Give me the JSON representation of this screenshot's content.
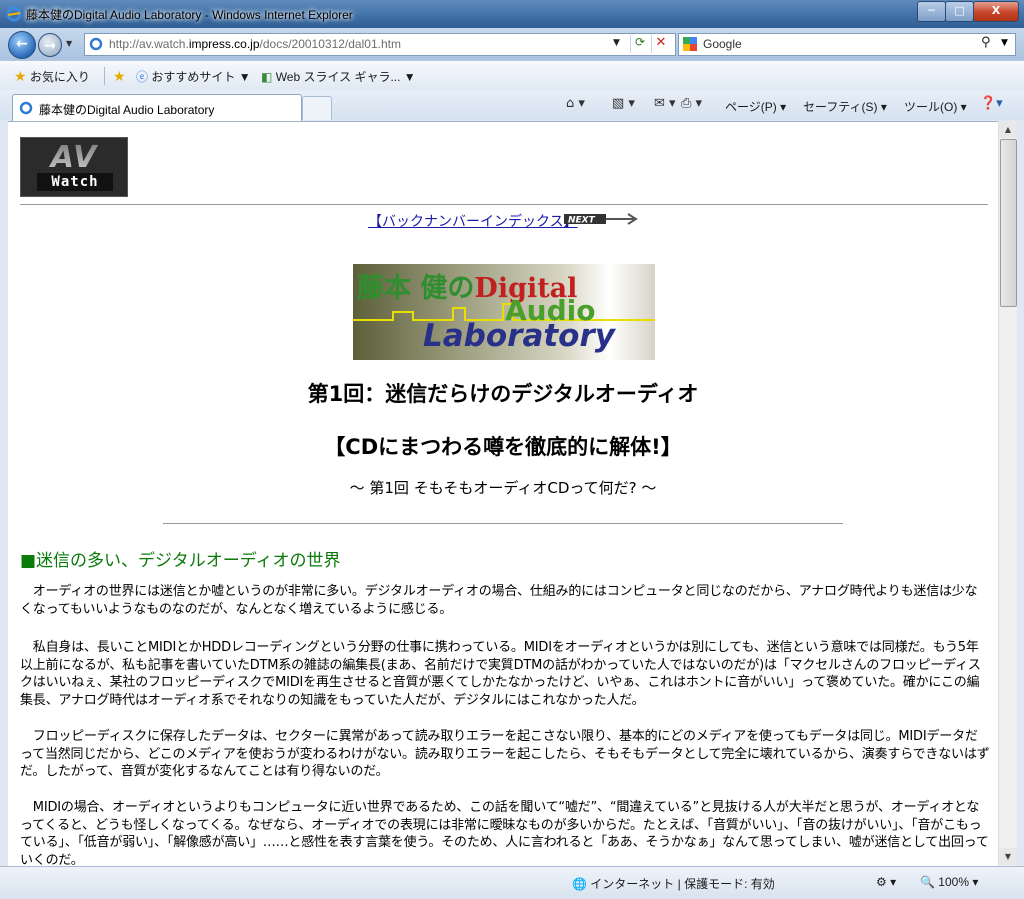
{
  "window": {
    "title": "藤本健のDigital Audio Laboratory - Windows Internet Explorer",
    "min_label": "─",
    "max_label": "□",
    "close_label": "X"
  },
  "nav": {
    "url_prefix": "http://av.watch.",
    "url_domain": "impress.co.jp",
    "url_path": "/docs/20010312/dal01.htm",
    "search_placeholder": "Google"
  },
  "favorites": {
    "favorites_label": "お気に入り",
    "recommended_label": "おすすめサイト ▼",
    "webslice_label": "Web スライス ギャラ... ▼"
  },
  "tab": {
    "title": "藤本健のDigital Audio Laboratory"
  },
  "commands": {
    "page": "ページ(P) ▾",
    "safety": "セーフティ(S) ▾",
    "tools": "ツール(O) ▾"
  },
  "page": {
    "logo_av": "AV",
    "logo_watch": "Watch",
    "back_link": "【バックナンバーインデックス】",
    "next_label": "NEXT",
    "banner_line1_a": "藤本 健の",
    "banner_line1_b": "Digital",
    "banner_line2": "Audio",
    "banner_line3": "Laboratory",
    "heading1": "第1回：迷信だらけのデジタルオーディオ",
    "heading2": "【CDにまつわる噂を徹底的に解体!】",
    "heading3": "～ 第1回 そもそもオーディオCDって何だ? ～",
    "section_title": "■迷信の多い、デジタルオーディオの世界",
    "paragraphs": [
      "　オーディオの世界には迷信とか嘘というのが非常に多い。デジタルオーディオの場合、仕組み的にはコンピュータと同じなのだから、アナログ時代よりも迷信は少なくなってもいいようなものなのだが、なんとなく増えているように感じる。",
      "　私自身は、長いことMIDIとかHDDレコーディングという分野の仕事に携わっている。MIDIをオーディオというかは別にしても、迷信という意味では同様だ。もう5年以上前になるが、私も記事を書いていたDTM系の雑誌の編集長(まあ、名前だけで実質DTMの話がわかっていた人ではないのだが)は「マクセルさんのフロッピーディスクはいいねぇ、某社のフロッピーディスクでMIDIを再生させると音質が悪くてしかたなかったけど、いやぁ、これはホントに音がいい」って褒めていた。確かにこの編集長、アナログ時代はオーディオ系でそれなりの知識をもっていた人だが、デジタルにはこれなかった人だ。",
      "　フロッピーディスクに保存したデータは、セクターに異常があって読み取りエラーを起こさない限り、基本的にどのメディアを使ってもデータは同じ。MIDIデータだって当然同じだから、どこのメディアを使おうが変わるわけがない。読み取りエラーを起こしたら、そもそもデータとして完全に壊れているから、演奏すらできないはずだ。したがって、音質が変化するなんてことは有り得ないのだ。",
      "　MIDIの場合、オーディオというよりもコンピュータに近い世界であるため、この話を聞いて“嘘だ”、“間違えている”と見抜ける人が大半だと思うが、オーディオとなってくると、どうも怪しくなってくる。なぜなら、オーディオでの表現には非常に曖昧なものが多いからだ。たとえば、「音質がいい」、「音の抜けがいい」、「音がこもっている」、「低音が弱い」、「解像感が高い」……と感性を表す言葉を使う。そのため、人に言われると「ああ、そうかなぁ」なんて思ってしまい、嘘が迷信として出回っていくのだ。"
    ]
  },
  "status": {
    "zone": "インターネット | 保護モード: 有効",
    "zoom": "100%"
  },
  "colors": {
    "section": "#0a7a0a",
    "link": "#1a1aa8"
  }
}
